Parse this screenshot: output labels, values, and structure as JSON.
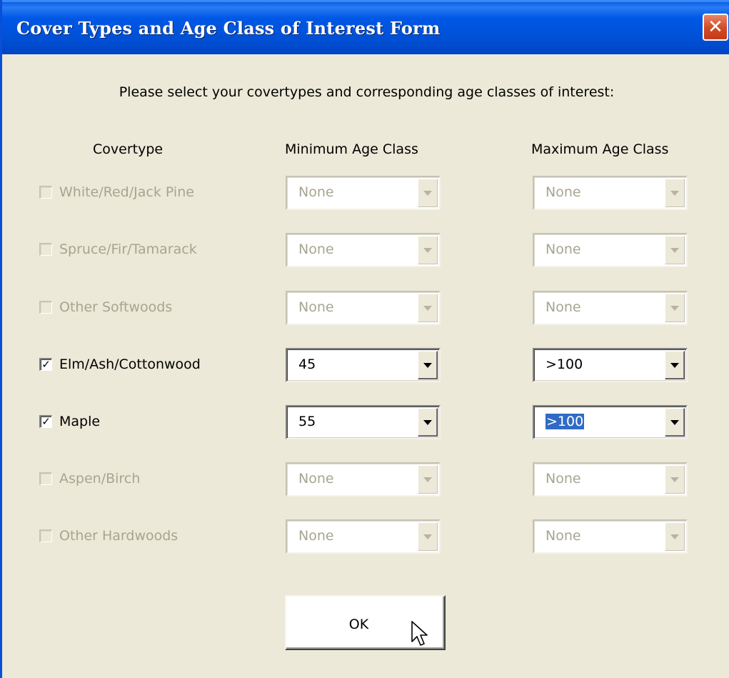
{
  "window": {
    "title": "Cover Types and Age Class of Interest Form",
    "close_glyph": "✕",
    "close_icon": "close-icon"
  },
  "instruction": "Please select your covertypes and corresponding age classes of interest:",
  "columns": {
    "covertype": "Covertype",
    "min_age": "Minimum Age Class",
    "max_age": "Maximum Age Class"
  },
  "rows": [
    {
      "label": "White/Red/Jack Pine",
      "checked": false,
      "enabled": false,
      "min": "None",
      "max": "None",
      "max_selected": false
    },
    {
      "label": "Spruce/Fir/Tamarack",
      "checked": false,
      "enabled": false,
      "min": "None",
      "max": "None",
      "max_selected": false
    },
    {
      "label": "Other Softwoods",
      "checked": false,
      "enabled": false,
      "min": "None",
      "max": "None",
      "max_selected": false
    },
    {
      "label": "Elm/Ash/Cottonwood",
      "checked": true,
      "enabled": true,
      "min": "45",
      "max": ">100",
      "max_selected": false
    },
    {
      "label": "Maple",
      "checked": true,
      "enabled": true,
      "min": "55",
      "max": ">100",
      "max_selected": true
    },
    {
      "label": "Aspen/Birch",
      "checked": false,
      "enabled": false,
      "min": "None",
      "max": "None",
      "max_selected": false
    },
    {
      "label": "Other Hardwoods",
      "checked": false,
      "enabled": false,
      "min": "None",
      "max": "None",
      "max_selected": false
    }
  ],
  "ok_label": "OK",
  "colors": {
    "titlebar": "#0054e3",
    "dialog_bg": "#ece9d8",
    "disabled_text": "#a7a591",
    "selection": "#316ac5"
  }
}
